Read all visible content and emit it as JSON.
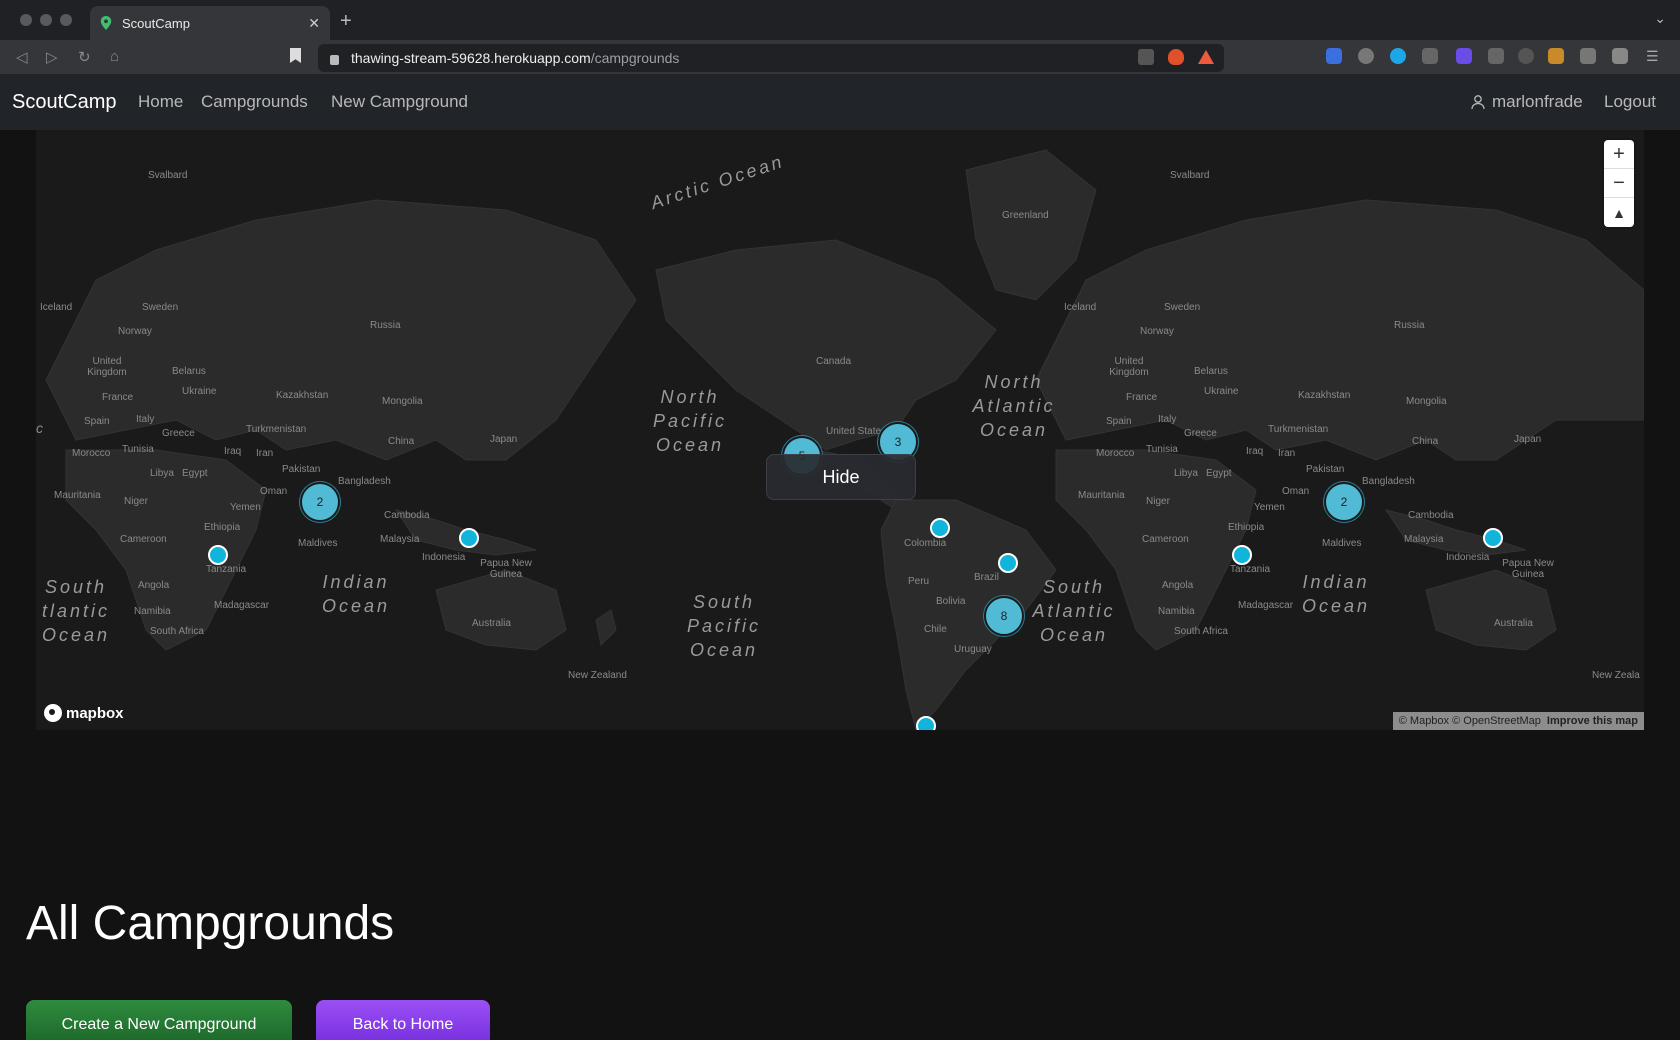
{
  "browser": {
    "tab_title": "ScoutCamp",
    "url_host": "thawing-stream-59628.herokuapp.com",
    "url_path": "/campgrounds",
    "new_tab_icon": "plus-icon"
  },
  "nav": {
    "brand": "ScoutCamp",
    "links": [
      "Home",
      "Campgrounds",
      "New Campground"
    ],
    "username": "marlonfrade",
    "logout": "Logout"
  },
  "map": {
    "oceans": {
      "arctic": "Arctic Ocean",
      "north_pacific": "North Pacific Ocean",
      "north_atlantic": "North Atlantic Ocean",
      "south_pacific": "South Pacific Ocean",
      "south_atlantic": "South Atlantic Ocean",
      "south_atlantic_left": "South tlantic Ocean",
      "indian": "Indian Ocean",
      "indian_right": "Indian Ocean"
    },
    "places": {
      "svalbard": "Svalbard",
      "svalbard2": "Svalbard",
      "greenland": "Greenland",
      "iceland": "Iceland",
      "iceland2": "Iceland",
      "sweden": "Sweden",
      "sweden2": "Sweden",
      "norway": "Norway",
      "norway2": "Norway",
      "russia": "Russia",
      "russia2": "Russia",
      "uk": "United Kingdom",
      "uk2": "United Kingdom",
      "belarus": "Belarus",
      "belarus2": "Belarus",
      "ukraine": "Ukraine",
      "ukraine2": "Ukraine",
      "france": "France",
      "france2": "France",
      "kazakhstan": "Kazakhstan",
      "kazakhstan2": "Kazakhstan",
      "mongolia": "Mongolia",
      "mongolia2": "Mongolia",
      "spain": "Spain",
      "spain2": "Spain",
      "italy": "Italy",
      "italy2": "Italy",
      "greece": "Greece",
      "greece2": "Greece",
      "turkmenistan": "Turkmenistan",
      "turkmenistan2": "Turkmenistan",
      "china": "China",
      "china2": "China",
      "japan": "Japan",
      "japan2": "Japan",
      "morocco": "Morocco",
      "morocco2": "Morocco",
      "tunisia": "Tunisia",
      "tunisia2": "Tunisia",
      "iraq": "Iraq",
      "iraq2": "Iraq",
      "iran": "Iran",
      "iran2": "Iran",
      "libya": "Libya",
      "libya2": "Libya",
      "egypt": "Egypt",
      "egypt2": "Egypt",
      "pakistan": "Pakistan",
      "pakistan2": "Pakistan",
      "bangladesh": "Bangladesh",
      "bangladesh2": "Bangladesh",
      "oman": "Oman",
      "oman2": "Oman",
      "mauritania": "Mauritania",
      "mauritania2": "Mauritania",
      "niger": "Niger",
      "niger2": "Niger",
      "yemen": "Yemen",
      "yemen2": "Yemen",
      "cambodia": "Cambodia",
      "cambodia2": "Cambodia",
      "ethiopia": "Ethiopia",
      "ethiopia2": "Ethiopia",
      "maldives": "Maldives",
      "maldives2": "Maldives",
      "malaysia": "Malaysia",
      "malaysia2": "Malaysia",
      "cameroon": "Cameroon",
      "cameroon2": "Cameroon",
      "indonesia": "Indonesia",
      "indonesia2": "Indonesia",
      "png": "Papua New Guinea",
      "png2": "Papua New Guinea",
      "tanzania": "Tanzania",
      "tanzania2": "Tanzania",
      "angola": "Angola",
      "angola2": "Angola",
      "namibia": "Namibia",
      "namibia2": "Namibia",
      "madagascar": "Madagascar",
      "madagascar2": "Madagascar",
      "south_africa": "South Africa",
      "south_africa2": "South Africa",
      "australia": "Australia",
      "australia2": "Australia",
      "new_zealand": "New Zealand",
      "new_zealand2": "New Zeala",
      "canada": "Canada",
      "united_states": "United States",
      "colombia": "Colombia",
      "peru": "Peru",
      "brazil": "Brazil",
      "bolivia": "Bolivia",
      "chile": "Chile",
      "uruguay": "Uruguay",
      "c_fragment": "c"
    },
    "clusters": [
      {
        "count": "2"
      },
      {
        "count": "3"
      },
      {
        "count": "5"
      },
      {
        "count": "8"
      },
      {
        "count": "2"
      }
    ],
    "hide_button": "Hide",
    "mapbox_logo": "mapbox",
    "attribution": "© Mapbox © OpenStreetMap",
    "improve": "Improve this map"
  },
  "main": {
    "heading": "All Campgrounds",
    "create_button": "Create a New Campground",
    "back_button": "Back to Home"
  }
}
